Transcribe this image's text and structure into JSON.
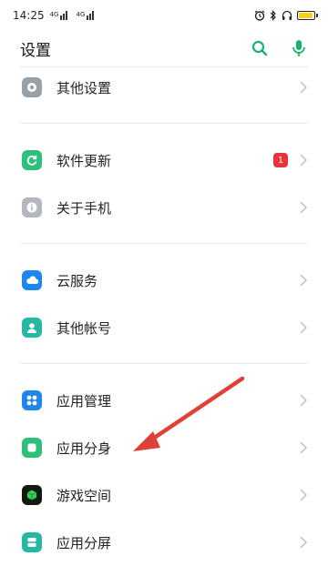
{
  "status_bar": {
    "time": "14:25",
    "sim1_tag": "4G",
    "sim2_tag": "4G",
    "battery_level": 0.85,
    "battery_color": "#f5d021"
  },
  "header": {
    "title": "设置",
    "icons": [
      "search-icon",
      "microphone-icon"
    ],
    "accent": "#1bb36c"
  },
  "settings": {
    "other_settings": {
      "label": "其他设置",
      "icon": "gear-icon"
    },
    "software_update": {
      "label": "软件更新",
      "icon": "update-icon",
      "badge": "1"
    },
    "about_phone": {
      "label": "关于手机",
      "icon": "info-icon"
    },
    "cloud_service": {
      "label": "云服务",
      "icon": "cloud-icon"
    },
    "other_accounts": {
      "label": "其他帐号",
      "icon": "user-icon"
    },
    "app_management": {
      "label": "应用管理",
      "icon": "apps-grid-icon"
    },
    "app_clone": {
      "label": "应用分身",
      "icon": "app-clone-icon"
    },
    "game_space": {
      "label": "游戏空间",
      "icon": "game-cube-icon"
    },
    "split_screen": {
      "label": "应用分屏",
      "icon": "split-screen-icon"
    }
  },
  "annotation": {
    "arrow_color": "#e0403a"
  }
}
